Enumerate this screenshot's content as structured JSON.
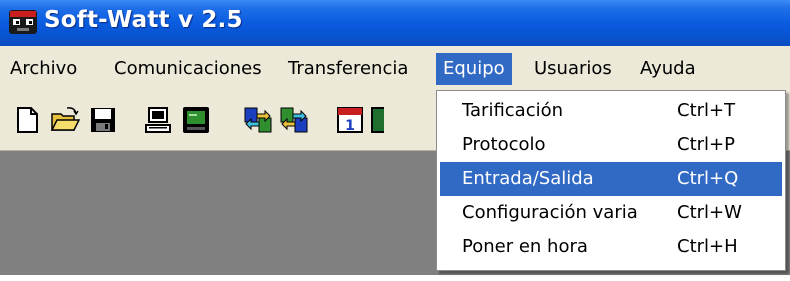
{
  "window": {
    "title": "Soft-Watt v 2.5",
    "app_icon": "app-face-icon"
  },
  "menubar": {
    "items": [
      {
        "label": "Archivo"
      },
      {
        "label": "Comunicaciones"
      },
      {
        "label": "Transferencia"
      },
      {
        "label": "Equipo",
        "active": true
      },
      {
        "label": "Usuarios"
      },
      {
        "label": "Ayuda"
      }
    ]
  },
  "toolbar": {
    "icons": [
      "new-document-icon",
      "open-folder-icon",
      "save-disk-icon",
      "computer-icon",
      "monitor-icon",
      "transfer-up-icon",
      "transfer-down-icon",
      "calendar-icon"
    ]
  },
  "equipo_menu": {
    "items": [
      {
        "label": "Tarificación",
        "shortcut": "Ctrl+T"
      },
      {
        "label": "Protocolo",
        "shortcut": "Ctrl+P"
      },
      {
        "label": "Entrada/Salida",
        "shortcut": "Ctrl+Q",
        "highlighted": true
      },
      {
        "label": "Configuración varia",
        "shortcut": "Ctrl+W"
      },
      {
        "label": "Poner en hora",
        "shortcut": "Ctrl+H"
      }
    ]
  },
  "colors": {
    "titlebar": "#0a5ce0",
    "menu_highlight": "#316ac5",
    "workspace": "#808080",
    "chrome": "#ece9d8"
  }
}
